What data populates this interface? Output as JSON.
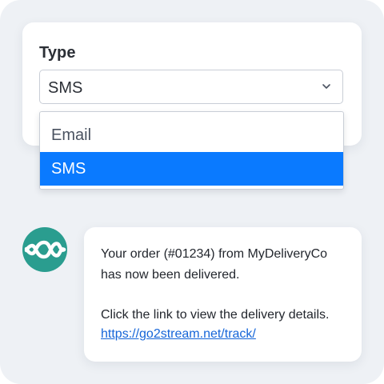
{
  "type_field": {
    "label": "Type",
    "selected_value": "SMS",
    "options": [
      {
        "label": "Email",
        "selected": false
      },
      {
        "label": "SMS",
        "selected": true
      }
    ],
    "chevron_icon": "chevron-down-icon"
  },
  "logo": {
    "icon": "wave-logo-icon",
    "color": "#2a9d8f"
  },
  "message": {
    "line_1": "Your order (#01234) from MyDeliveryCo",
    "line_2": "has now been delivered.",
    "line_3": "Click the link to view the delivery details.",
    "link": "https://go2stream.net/track/"
  },
  "colors": {
    "accent": "#0a7aff",
    "link": "#1565d8",
    "background": "#eef1f5",
    "logo": "#2a9d8f"
  }
}
